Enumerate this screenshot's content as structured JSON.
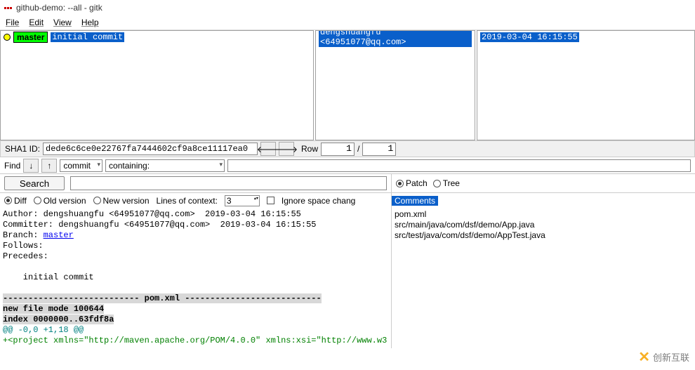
{
  "title": "github-demo: --all - gitk",
  "menubar": [
    "File",
    "Edit",
    "View",
    "Help"
  ],
  "history": {
    "branch": "master",
    "subject": "initial commit",
    "author": "dengshuangfu <64951077@qq.com>",
    "date": "2019-03-04 16:15:55"
  },
  "sha": {
    "label": "SHA1 ID:",
    "value": "dede6c6ce0e22767fa7444602cf9a8ce11117ea0",
    "row_label": "Row",
    "row_current": "1",
    "row_sep": "/",
    "row_total": "1"
  },
  "find": {
    "label": "Find",
    "mode": "commit",
    "scope": "containing:"
  },
  "search_btn": "Search",
  "view_radios": {
    "diff": "Diff",
    "old": "Old version",
    "new": "New version"
  },
  "tree_radios": {
    "patch": "Patch",
    "tree": "Tree"
  },
  "lines_label": "Lines of context:",
  "lines_value": "3",
  "ignore_space": "Ignore space chang",
  "comments_header": "Comments",
  "file_list": [
    "pom.xml",
    "src/main/java/com/dsf/demo/App.java",
    "src/test/java/com/dsf/demo/AppTest.java"
  ],
  "commit_details": {
    "author_line": "Author: dengshuangfu <64951077@qq.com>  2019-03-04 16:15:55",
    "committer_line": "Committer: dengshuangfu <64951077@qq.com>  2019-03-04 16:15:55",
    "branch_prefix": "Branch: ",
    "branch_name": "master",
    "follows": "Follows:",
    "precedes": "Precedes:",
    "message": "    initial commit"
  },
  "diff": {
    "sep": "--------------------------- pom.xml ---------------------------",
    "mode": "new file mode 100644",
    "index": "index 0000000..63fdf8a",
    "hunk": "@@ -0,0 +1,18 @@",
    "add1": "+<project xmlns=\"http://maven.apache.org/POM/4.0.0\" xmlns:xsi=\"http://www.w3"
  },
  "watermark": "创新互联"
}
